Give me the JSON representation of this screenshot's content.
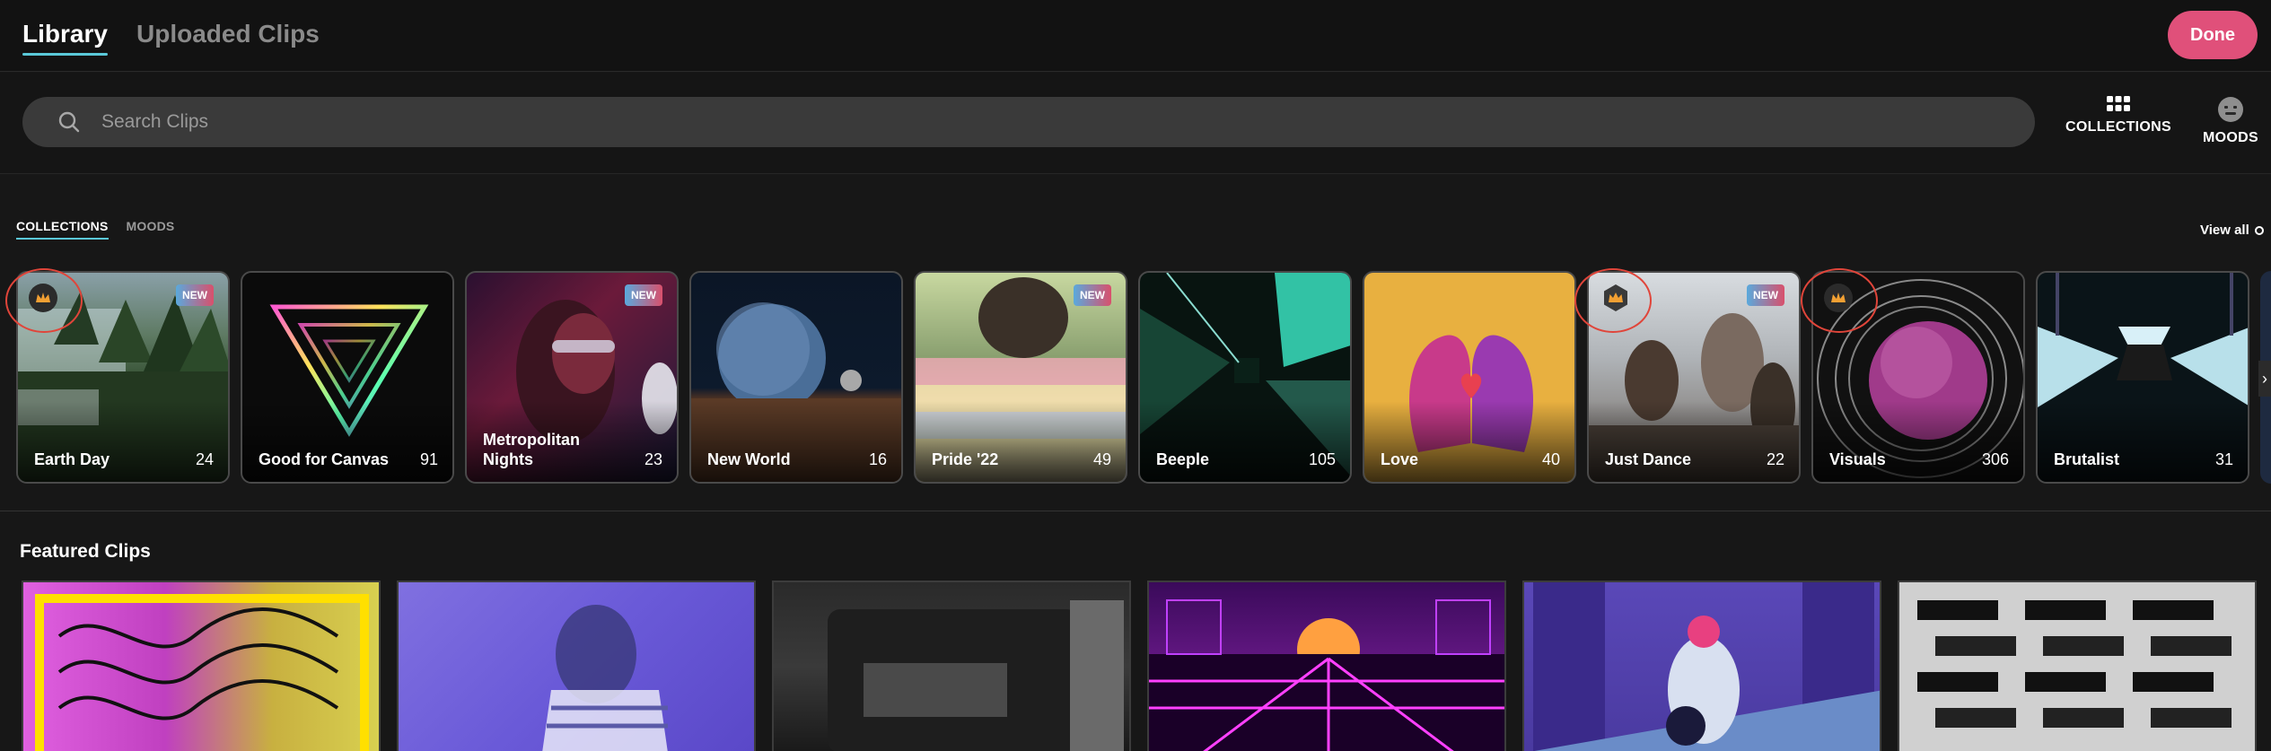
{
  "nav": {
    "tabs": [
      {
        "label": "Library",
        "active": true
      },
      {
        "label": "Uploaded Clips",
        "active": false
      }
    ],
    "done_label": "Done",
    "accent": "#e0507a"
  },
  "search": {
    "placeholder": "Search Clips",
    "value": ""
  },
  "top_buttons": {
    "collections_label": "COLLECTIONS",
    "moods_label": "MOODS"
  },
  "section": {
    "tabs": [
      {
        "label": "COLLECTIONS",
        "active": true
      },
      {
        "label": "MOODS",
        "active": false
      }
    ],
    "view_all": "View all"
  },
  "collections": [
    {
      "name": "Earth Day",
      "count": "24",
      "new": "NEW",
      "crown": true
    },
    {
      "name": "Good for Canvas",
      "count": "91"
    },
    {
      "name": "Metropolitan Nights",
      "count": "23",
      "new": "NEW"
    },
    {
      "name": "New World",
      "count": "16"
    },
    {
      "name": "Pride '22",
      "count": "49",
      "new": "NEW"
    },
    {
      "name": "Beeple",
      "count": "105"
    },
    {
      "name": "Love",
      "count": "40"
    },
    {
      "name": "Just Dance",
      "count": "22",
      "new": "NEW",
      "crown": true
    },
    {
      "name": "Visuals",
      "count": "306",
      "crown": true
    },
    {
      "name": "Brutalist",
      "count": "31"
    }
  ],
  "featured": {
    "title": "Featured Clips"
  }
}
